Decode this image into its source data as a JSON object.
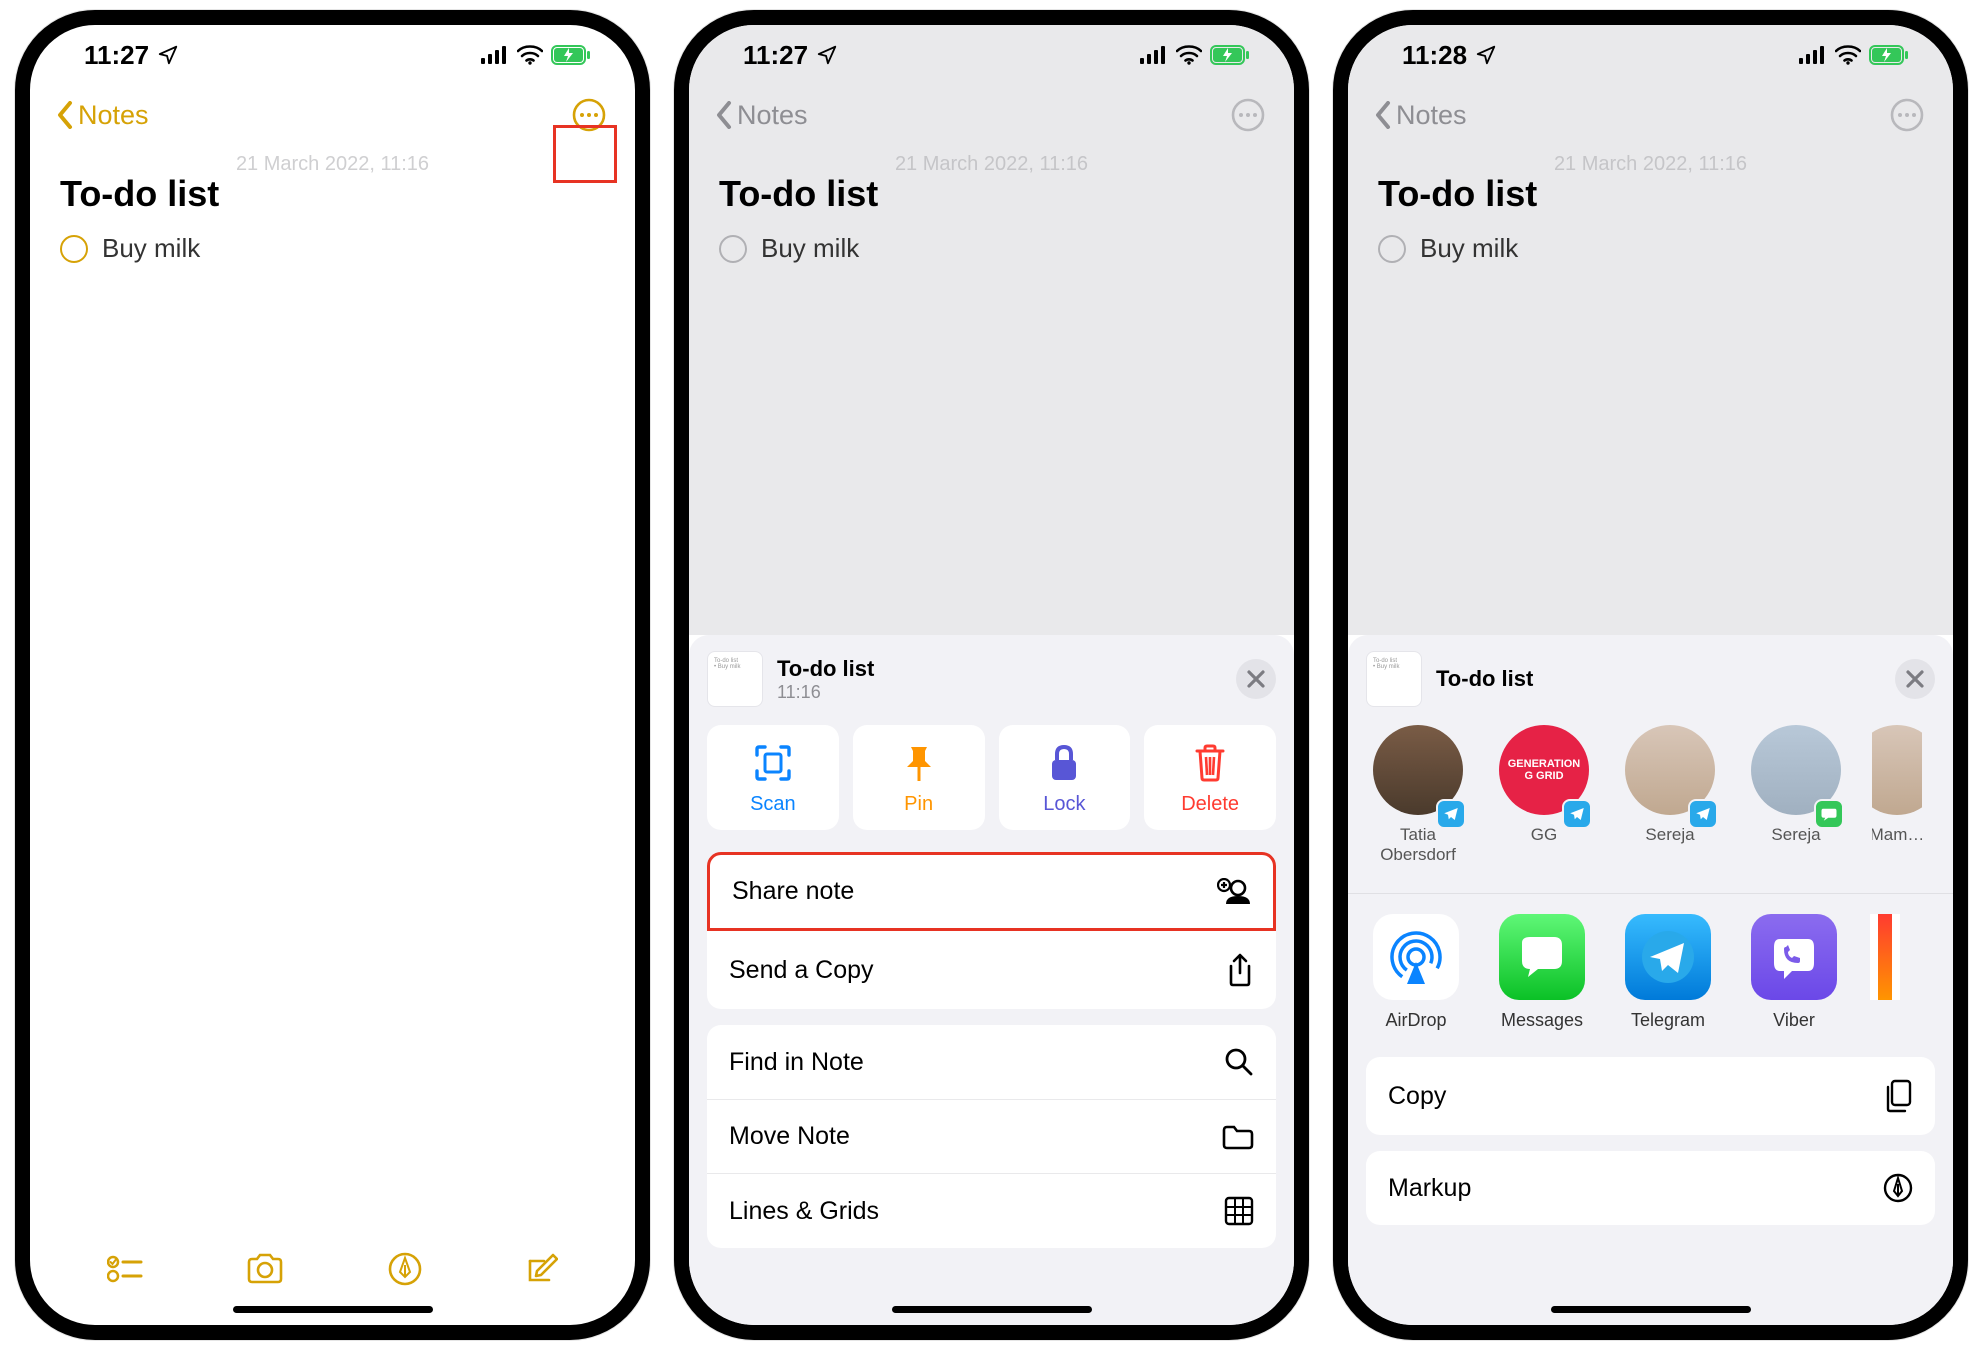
{
  "common": {
    "statusbar": {
      "signal": "cell-signal-icon",
      "wifi": "wifi-icon",
      "battery": "battery-charging-icon"
    },
    "back_label": "Notes",
    "header_subtitle": "21 March 2022, 11:16",
    "note_title": "To-do list",
    "todo_item": "Buy milk"
  },
  "phone1": {
    "time": "11:27",
    "toolbar": {
      "checklist": "checklist",
      "camera": "camera",
      "pen": "pen",
      "compose": "compose"
    }
  },
  "phone2": {
    "time": "11:27",
    "sheet_title": "To-do list",
    "sheet_time": "11:16",
    "quick": {
      "scan": "Scan",
      "pin": "Pin",
      "lock": "Lock",
      "delete": "Delete"
    },
    "rows1": {
      "share": "Share note",
      "sendcopy": "Send a Copy"
    },
    "rows2": {
      "find": "Find in Note",
      "move": "Move Note",
      "lines": "Lines & Grids"
    }
  },
  "phone3": {
    "time": "11:28",
    "sheet_title": "To-do list",
    "contacts": [
      {
        "name": "Tatia Obersdorf",
        "badge": "tg"
      },
      {
        "name": "GG",
        "badge": "tg",
        "style": "gg",
        "label": "GENERATION\nGGRID"
      },
      {
        "name": "Sereja",
        "badge": "tg",
        "style": "face"
      },
      {
        "name": "Sereja",
        "badge": "msg",
        "style": "pair"
      },
      {
        "name": "Mam…",
        "badge": "",
        "style": "face"
      }
    ],
    "apps": [
      {
        "name": "AirDrop",
        "style": "airdrop"
      },
      {
        "name": "Messages",
        "style": "messages"
      },
      {
        "name": "Telegram",
        "style": "telegram"
      },
      {
        "name": "Viber",
        "style": "viber"
      },
      {
        "name": "",
        "style": "more"
      }
    ],
    "rows": {
      "copy": "Copy",
      "markup": "Markup"
    }
  }
}
